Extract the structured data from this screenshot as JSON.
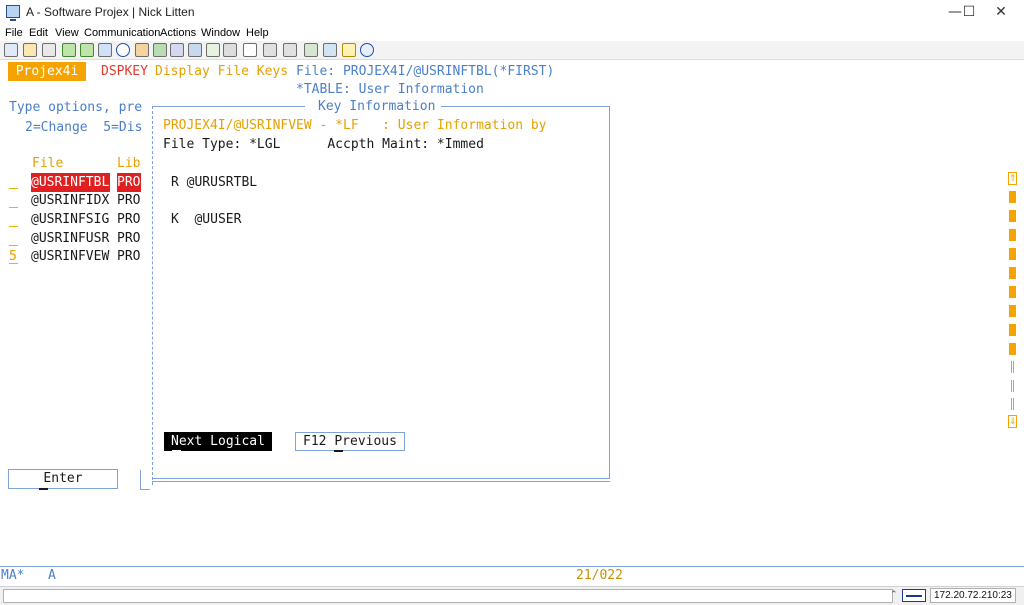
{
  "window": {
    "title": "A - Software Projex | Nick Litten",
    "minimize": "—",
    "maximize": "☐",
    "close": "✕"
  },
  "menu": [
    "File",
    "Edit",
    "View",
    "Communication",
    "Actions",
    "Window",
    "Help"
  ],
  "toolbar_icons": [
    "copy-icon",
    "paste-icon",
    "print-icon",
    "send-icon",
    "receive-icon",
    "macro-icon",
    "record-icon",
    "stop-icon",
    "play-icon",
    "keypad-icon",
    "display-icon",
    "color-icon",
    "settings-icon",
    "keyboard-icon",
    "session-icon",
    "disconnect-icon",
    "connect-icon",
    "upload-icon",
    "notes-icon",
    "help-icon"
  ],
  "screen": {
    "badge": "Projex4i",
    "command": "DSPKEY",
    "header_title": "Display File Keys",
    "header_file": "File: PROJEX4I/@USRINFTBL(*FIRST)",
    "header_table": "*TABLE: User Information",
    "type_options": "Type options, pre",
    "options": "2=Change  5=Dis",
    "col_file": "File",
    "col_lib": "Lib",
    "rows": [
      {
        "opt": "",
        "file": "@USRINFTBL",
        "lib": "PRO"
      },
      {
        "opt": "",
        "file": "@USRINFIDX",
        "lib": "PRO"
      },
      {
        "opt": "",
        "file": "@USRINFSIG",
        "lib": "PRO"
      },
      {
        "opt": "",
        "file": "@USRINFUSR",
        "lib": "PRO"
      },
      {
        "opt": "5",
        "file": "@USRINFVEW",
        "lib": "PRO"
      }
    ],
    "enter_button": "Enter"
  },
  "popup": {
    "title": "Key Information",
    "file_line": "PROJEX4I/@USRINFVEW - *LF   : User Information by",
    "type_line": "File Type: *LGL      Accpth Maint: *Immed",
    "record_line": "R @URUSRTBL",
    "key_line": "K  @UUSER",
    "next_button": "Next Logical",
    "prev_button": "F12 Previous"
  },
  "oia": {
    "mode": "MA*",
    "session": "A",
    "cursor_pos": "21/022"
  },
  "status": {
    "ip": "172.20.72.210:23"
  },
  "colors": {
    "accent_orange": "#f5a300",
    "field_blue": "#4a7fc9",
    "command_red": "#e23b2c"
  }
}
